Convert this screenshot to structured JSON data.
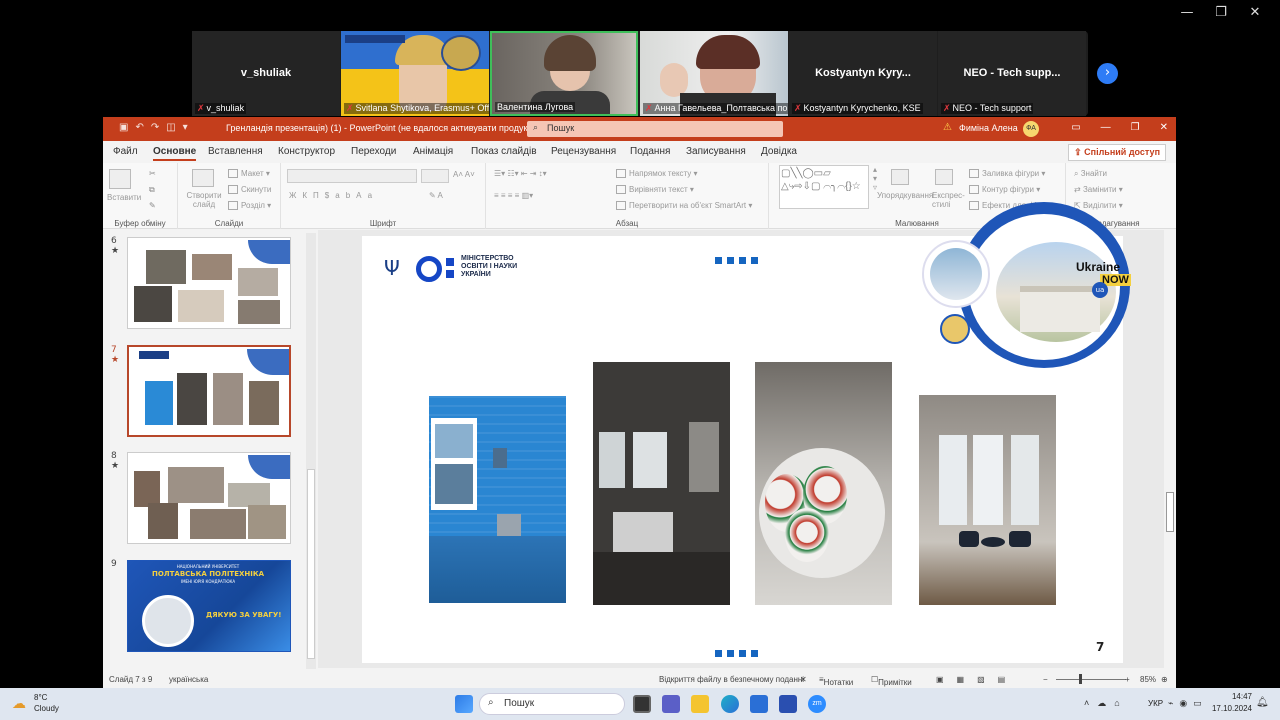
{
  "window_controls": [
    "—",
    "❐",
    "✕"
  ],
  "zoom": {
    "tiles": [
      {
        "name": "v_shuliak",
        "caption": "v_shuliak",
        "video": false
      },
      {
        "name": "",
        "caption": "Svitlana Shytikova, Erasmus+ Off...",
        "video": true
      },
      {
        "name": "",
        "caption": "Валентина Лугова",
        "video": true
      },
      {
        "name": "",
        "caption": "Анна Гавельева_Полтавська по...",
        "video": true
      },
      {
        "name": "Kostyantyn Kyry...",
        "caption": "Kostyantyn Kyrychenko, KSE",
        "video": false
      },
      {
        "name": "NEO - Tech supp...",
        "caption": "NEO - Tech support",
        "video": false
      }
    ],
    "next_icon": "chevron-right-icon"
  },
  "ppt": {
    "title": "Гренландія презентація) (1)  -  PowerPoint (не вдалося активувати продукт)",
    "search_placeholder": "Пошук",
    "user": "Фиміна Алена",
    "user_initials": "ФА",
    "menu": [
      "Файл",
      "Основне",
      "Вставлення",
      "Конструктор",
      "Переходи",
      "Анімація",
      "Показ слайдів",
      "Рецензування",
      "Подання",
      "Записування",
      "Довідка"
    ],
    "active_menu": "Основне",
    "share_label": "Спільний доступ",
    "ribbon": {
      "groups": [
        "Буфер обміну",
        "Слайди",
        "Шрифт",
        "Абзац",
        "Малювання",
        "Редагування"
      ],
      "paste": "Вставити",
      "new_slide": "Створити слайд",
      "layout": "Макет",
      "reset": "Скинути",
      "section": "Розділ",
      "text_direction": "Напрямок тексту",
      "align_text": "Вирівняти текст",
      "smartart": "Перетворити на об'єкт SmartArt",
      "arrange": "Упорядкування",
      "quick_styles": "Експрес-стилі",
      "shape_fill": "Заливка фігури",
      "shape_outline": "Контур фігури",
      "shape_effects": "Ефекти для фігур",
      "find": "Знайти",
      "replace": "Замінити",
      "select": "Виділити"
    },
    "thumbnails": [
      {
        "num": "6",
        "star": "★",
        "kind": "photos"
      },
      {
        "num": "7",
        "star": "★",
        "kind": "photos-row",
        "selected": true
      },
      {
        "num": "8",
        "star": "★",
        "kind": "photos"
      },
      {
        "num": "9",
        "star": "",
        "kind": "final"
      }
    ],
    "thumb9": {
      "university": "НАЦІОНАЛЬНИЙ УНІВЕРСИТЕТ",
      "poltava": "ПОЛТАВСЬКА ПОЛІТЕХНІКА",
      "kondratyuk": "ІМЕНІ ЮРІЯ КОНДРАТЮКА",
      "thanks": "ДЯКУЮ ЗА УВАГУ!"
    },
    "slide": {
      "ministry_line1": "МІНІСТЕРСТВО",
      "ministry_line2": "ОСВІТИ І НАУКИ",
      "ministry_line3": "УКРАЇНИ",
      "ukraine_now": "Ukraine",
      "now": "NOW",
      "ua": "ua",
      "page_number": "7"
    },
    "status": {
      "slide_info": "Слайд 7 з 9",
      "language": "українська",
      "safe_view": "Відкриття файлу в безпечному поданні",
      "notes": "Нотатки",
      "comments": "Примітки",
      "zoom": "85%"
    }
  },
  "taskbar": {
    "temp": "8°C",
    "weather": "Cloudy",
    "search": "Пошук",
    "lang": "УКР",
    "time": "14:47",
    "date": "17.10.2024"
  }
}
